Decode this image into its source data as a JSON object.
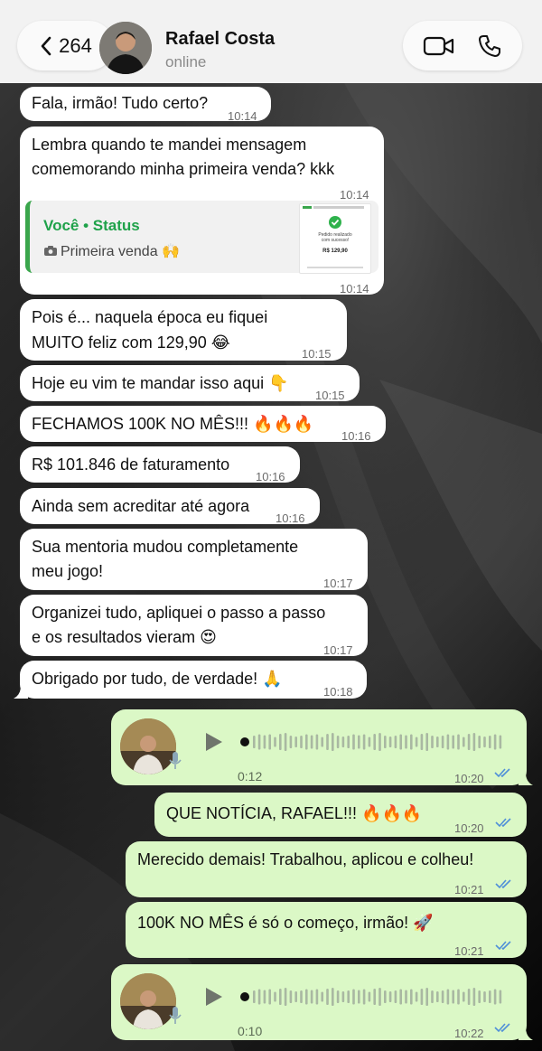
{
  "header": {
    "back_count": "264",
    "contact_name": "Rafael Costa",
    "contact_status": "online",
    "icons": [
      "chevron-left-icon",
      "video-camera-icon",
      "phone-icon"
    ]
  },
  "messages": [
    {
      "dir": "in",
      "text": "Fala, irmão! Tudo certo?",
      "time": "10:14"
    },
    {
      "dir": "in",
      "text": "Lembra quando te mandei mensagem",
      "text2": "comemorando minha primeira venda? kkk",
      "time": "10:14"
    },
    {
      "dir": "in",
      "quote_title": "Você • Status",
      "quote_text": "Primeira venda 🙌",
      "time": "10:14",
      "thumb": {
        "line1": "Pedido realizado",
        "line2": "com sucesso!",
        "amount": "R$ 129,90"
      }
    },
    {
      "dir": "in",
      "text": "Pois é... naquela época eu fiquei",
      "text2": "MUITO feliz com 129,90 😂",
      "time": "10:15"
    },
    {
      "dir": "in",
      "text": "Hoje eu vim te mandar isso aqui 👇",
      "time": "10:15"
    },
    {
      "dir": "in",
      "text": "FECHAMOS 100K NO MÊS!!! 🔥🔥🔥",
      "time": "10:16"
    },
    {
      "dir": "in",
      "text": "R$ 101.846 de faturamento",
      "time": "10:16"
    },
    {
      "dir": "in",
      "text": "Ainda sem acreditar até agora",
      "time": "10:16"
    },
    {
      "dir": "in",
      "text": "Sua mentoria mudou completamente",
      "text2": "meu jogo!",
      "time": "10:17"
    },
    {
      "dir": "in",
      "text": "Organizei tudo, apliquei o passo a passo",
      "text2": "e os resultados vieram 😍",
      "time": "10:17"
    },
    {
      "dir": "in",
      "text": "Obrigado por tudo, de verdade! 🙏",
      "time": "10:18"
    },
    {
      "dir": "out",
      "type": "audio",
      "duration": "0:12",
      "time": "10:20"
    },
    {
      "dir": "out",
      "text": "QUE NOTÍCIA, RAFAEL!!! 🔥🔥🔥",
      "time": "10:20"
    },
    {
      "dir": "out",
      "text": "Merecido demais! Trabalhou, aplicou e colheu!",
      "time": "10:21"
    },
    {
      "dir": "out",
      "text": "100K NO MÊS é só o começo, irmão! 🚀",
      "time": "10:21"
    },
    {
      "dir": "out",
      "type": "audio",
      "duration": "0:10",
      "time": "10:22"
    }
  ],
  "colors": {
    "incoming": "#ffffff",
    "outgoing": "#dbf8c6",
    "read_ticks": "#4f8fd9",
    "status_green": "#1fa24a"
  }
}
